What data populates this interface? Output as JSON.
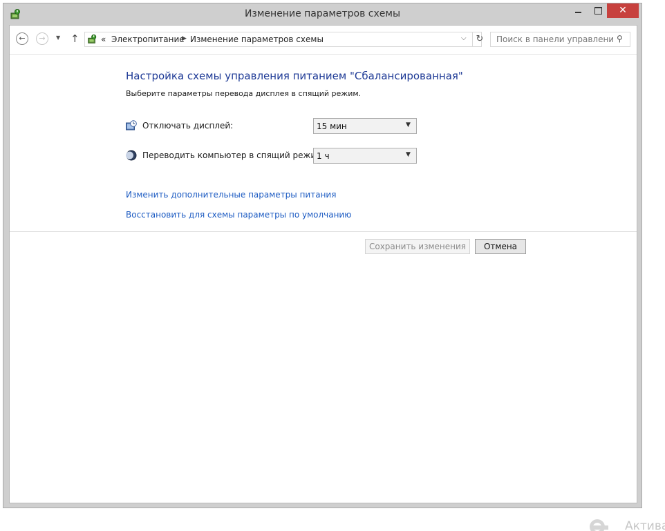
{
  "window": {
    "title": "Изменение параметров схемы",
    "close_glyph": "✕"
  },
  "navbar": {
    "back_glyph": "←",
    "forward_glyph": "→",
    "recent_glyph": "▼",
    "up_glyph": "↑",
    "address": {
      "overflow": "«",
      "crumb1": "Электропитание",
      "crumb_sep": "▶",
      "crumb2": "Изменение параметров схемы",
      "dropdown_glyph": "⌵",
      "refresh_glyph": "↻"
    },
    "search": {
      "placeholder": "Поиск в панели управления",
      "icon_glyph": "⚲"
    }
  },
  "content": {
    "heading": "Настройка схемы управления питанием \"Сбалансированная\"",
    "subtext": "Выберите параметры перевода дисплея в спящий режим.",
    "settings": [
      {
        "label": "Отключать дисплей:",
        "value": "15 мин"
      },
      {
        "label": "Переводить компьютер в спящий режим:",
        "value": "1 ч"
      }
    ],
    "select_arrow": "▼",
    "links": [
      "Изменить дополнительные параметры питания",
      "Восстановить для схемы параметры по умолчанию"
    ],
    "buttons": {
      "save": "Сохранить изменения",
      "cancel": "Отмена"
    }
  },
  "watermark": {
    "text": "Актива"
  },
  "colors": {
    "heading": "#1e3a96",
    "link": "#1b5ac2",
    "close_button": "#c7413e"
  },
  "icons": {
    "app": "power-options-icon",
    "display": "display-clock-icon",
    "sleep": "moon-icon",
    "activation": "windows-activation-icon"
  }
}
